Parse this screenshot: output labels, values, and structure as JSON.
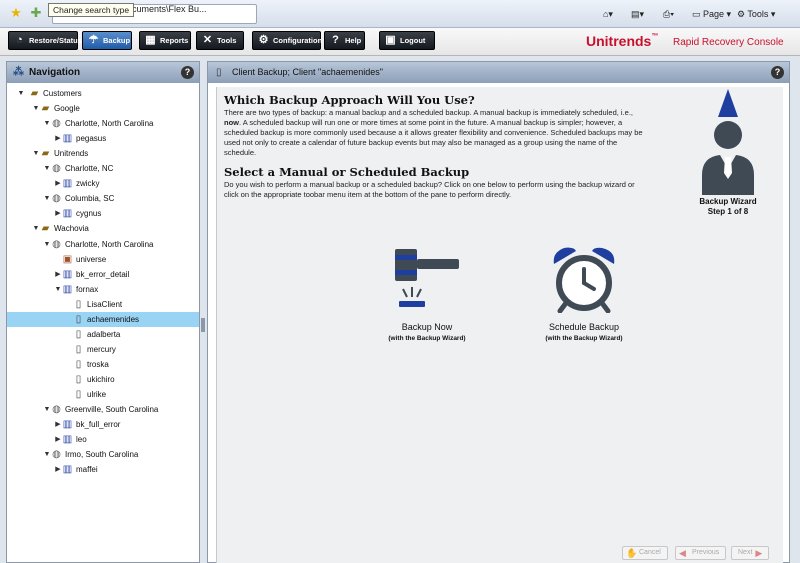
{
  "browser": {
    "tooltip": "Change search type",
    "address": "ampbell\\My Documents\\Flex Bu...",
    "page_menu": "Page",
    "tools_menu": "Tools"
  },
  "toolbar": {
    "restore_label": "Restore/Status",
    "backup_label": "Backup",
    "reports_label": "Reports",
    "tools_label": "Tools",
    "configuration_label": "Configuration",
    "help_label": "Help",
    "logout_label": "Logout"
  },
  "brand": {
    "name": "Unitrends",
    "tm": "™",
    "subtitle": "Rapid Recovery Console",
    "color": "#c8102e"
  },
  "navigation": {
    "title": "Navigation",
    "help": "?",
    "tree": [
      {
        "label": "Customers",
        "icon": "folder-icon"
      },
      {
        "label": "Google",
        "icon": "folder-icon"
      },
      {
        "label": "Charlotte, North Carolina",
        "icon": "globe-icon"
      },
      {
        "label": "pegasus",
        "icon": "server-icon"
      },
      {
        "label": "Unitrends",
        "icon": "folder-icon"
      },
      {
        "label": "Charlotte, NC",
        "icon": "globe-icon"
      },
      {
        "label": "zwicky",
        "icon": "server-icon"
      },
      {
        "label": "Columbia, SC",
        "icon": "globe-icon"
      },
      {
        "label": "cygnus",
        "icon": "server-icon"
      },
      {
        "label": "Wachovia",
        "icon": "folder-icon"
      },
      {
        "label": "Charlotte, North Carolina",
        "icon": "globe-icon"
      },
      {
        "label": "universe",
        "icon": "unitrends-appliance-icon"
      },
      {
        "label": "bk_error_detail",
        "icon": "server-icon"
      },
      {
        "label": "fornax",
        "icon": "server-icon"
      },
      {
        "label": "LisaClient",
        "icon": "client-icon"
      },
      {
        "label": "achaemenides",
        "icon": "client-icon"
      },
      {
        "label": "adalberta",
        "icon": "client-icon"
      },
      {
        "label": "mercury",
        "icon": "client-icon"
      },
      {
        "label": "troska",
        "icon": "client-icon"
      },
      {
        "label": "ukichiro",
        "icon": "client-icon"
      },
      {
        "label": "ulrike",
        "icon": "client-icon"
      },
      {
        "label": "Greenville, South Carolina",
        "icon": "globe-icon"
      },
      {
        "label": "bk_full_error",
        "icon": "server-icon"
      },
      {
        "label": "leo",
        "icon": "server-icon"
      },
      {
        "label": "Irmo, South Carolina",
        "icon": "globe-icon"
      },
      {
        "label": "maffei",
        "icon": "server-icon"
      }
    ],
    "selected": "achaemenides"
  },
  "main": {
    "header_title": "Client Backup; Client \"achaemenides\"",
    "help": "?",
    "heading1": "Which Backup Approach Will You Use?",
    "para1_a": "There are two types of backup: a manual backup and a scheduled backup.  A manual backup is immediately scheduled, i.e., ",
    "para1_now": "now",
    "para1_b": ". A scheduled backup will run one or more times at some point in the future. A manual backup is simpler; however, a scheduled backup is more commonly used because a it allows greater flexibility and convenience.  Scheduled backups may be used not only to create a calendar of future backup events but may also be managed as a group using the name of the schedule.",
    "heading2": "Select a Manual or Scheduled Backup",
    "para2": "Do you wish to perform a manual backup or a scheduled backup?  Click on one below to perform using the backup wizard or click on the appropriate toobar menu item at the bottom of the pane to perform directly.",
    "wizard_title": "Backup Wizard",
    "wizard_step": "Step 1 of 8",
    "backup_now_label": "Backup Now",
    "backup_now_sub": "(with the Backup Wizard)",
    "schedule_label": "Schedule Backup",
    "schedule_sub": "(with the Backup Wizard)",
    "accent_color": "#1f3fa0",
    "dark_icon_color": "#3f4a55"
  },
  "wizard_nav": {
    "cancel": "Cancel",
    "previous": "Previous",
    "next": "Next"
  }
}
